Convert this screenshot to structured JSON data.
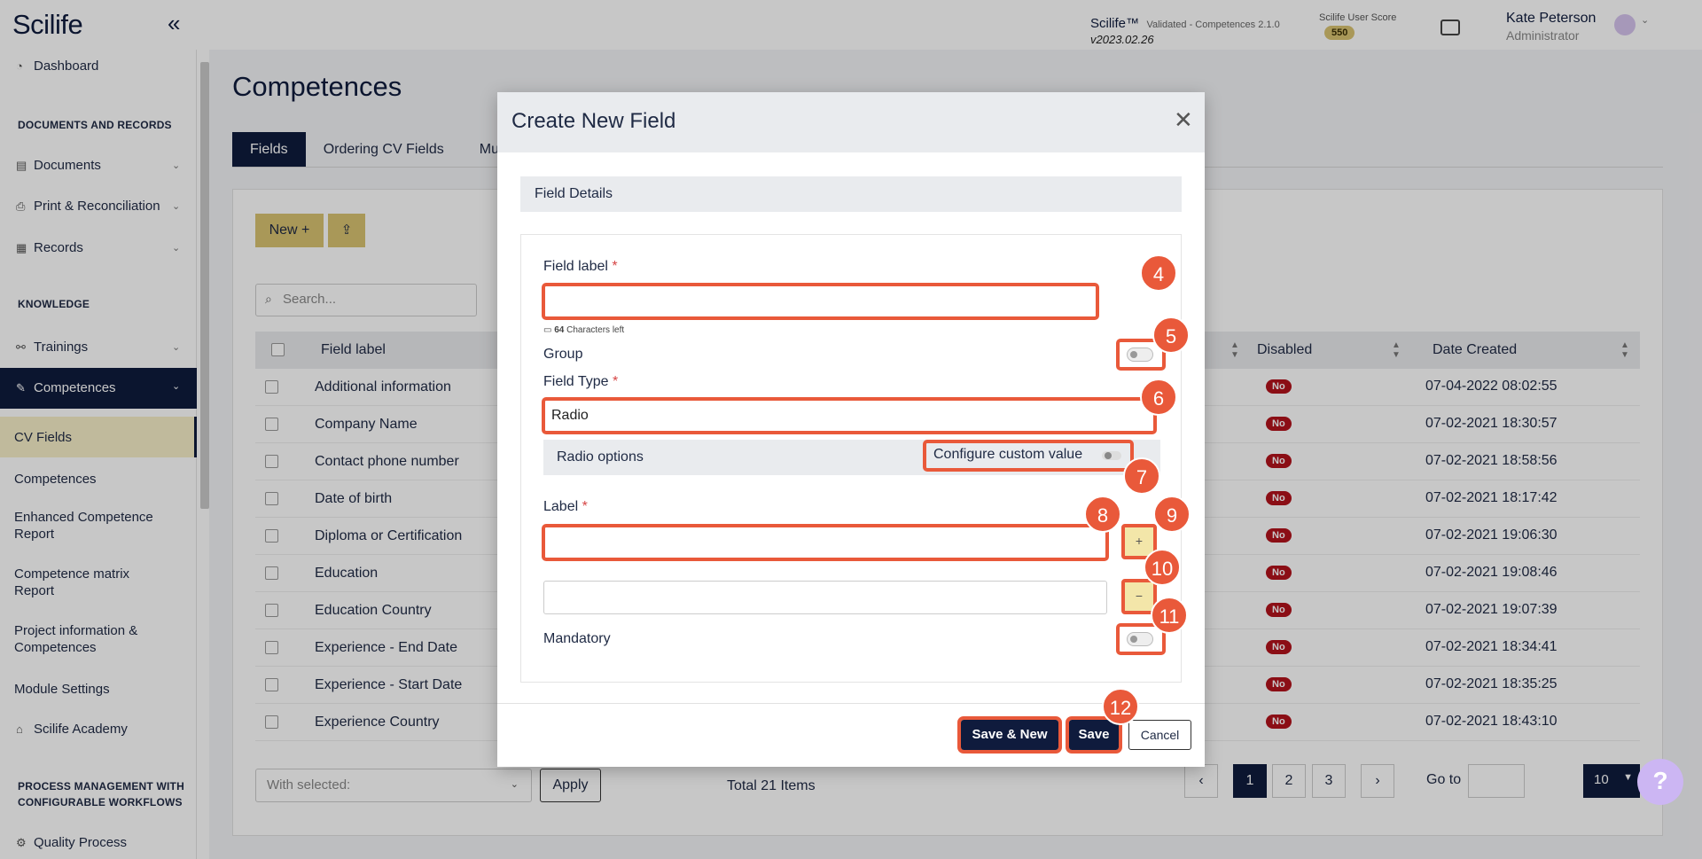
{
  "header": {
    "logo": "Scilife",
    "collapse_icon": "double-chevron-left-icon",
    "brand": "Scilife™",
    "edition": "Validated - Competences 2.1.0",
    "version": "v2023.02.26",
    "score_label": "Scilife User Score",
    "score_value": "550",
    "user_name": "Kate Peterson",
    "user_role": "Administrator"
  },
  "sidebar": {
    "dashboard": "Dashboard",
    "section_docs": "DOCUMENTS AND RECORDS",
    "documents": "Documents",
    "print": "Print & Reconciliation",
    "records": "Records",
    "section_knowledge": "KNOWLEDGE",
    "trainings": "Trainings",
    "competences": "Competences",
    "sub_items": [
      "CV Fields",
      "Competences",
      "Enhanced Competence Report",
      "Competence matrix Report",
      "Project information & Competences",
      "Module Settings"
    ],
    "academy": "Scilife Academy",
    "section_process": "PROCESS MANAGEMENT WITH CONFIGURABLE WORKFLOWS",
    "quality": "Quality Process"
  },
  "main": {
    "title": "Competences",
    "tabs": [
      "Fields",
      "Ordering CV Fields",
      "Mult"
    ],
    "new_label": "New +",
    "search_placeholder": "Search...",
    "columns": [
      "Field label",
      "Disabled",
      "Date Created"
    ],
    "rows": [
      {
        "label": "Additional information",
        "disabled": "No",
        "date": "07-04-2022 08:02:55"
      },
      {
        "label": "Company Name",
        "disabled": "No",
        "date": "07-02-2021 18:30:57"
      },
      {
        "label": "Contact phone number",
        "disabled": "No",
        "date": "07-02-2021 18:58:56"
      },
      {
        "label": "Date of birth",
        "disabled": "No",
        "date": "07-02-2021 18:17:42"
      },
      {
        "label": "Diploma or Certification",
        "disabled": "No",
        "date": "07-02-2021 19:06:30"
      },
      {
        "label": "Education",
        "disabled": "No",
        "date": "07-02-2021 19:08:46"
      },
      {
        "label": "Education Country",
        "disabled": "No",
        "date": "07-02-2021 19:07:39"
      },
      {
        "label": "Experience - End Date",
        "disabled": "No",
        "date": "07-02-2021 18:34:41"
      },
      {
        "label": "Experience - Start Date",
        "disabled": "No",
        "date": "07-02-2021 18:35:25"
      },
      {
        "label": "Experience Country",
        "disabled": "No",
        "date": "07-02-2021 18:43:10"
      }
    ],
    "with_selected": "With selected:",
    "apply": "Apply",
    "total": "Total 21 Items",
    "pages": [
      "1",
      "2",
      "3"
    ],
    "goto_label": "Go to",
    "per_page": "10",
    "help": "?"
  },
  "modal": {
    "title": "Create New Field",
    "section": "Field Details",
    "field_label": "Field label",
    "field_label_value": "",
    "chars_count": "64",
    "chars_text": "Characters left",
    "group": "Group",
    "field_type": "Field Type",
    "field_type_value": "Radio",
    "radio_options": "Radio options",
    "configure_custom": "Configure custom value",
    "label": "Label",
    "label_value": "",
    "plus": "+",
    "minus": "−",
    "mandatory": "Mandatory",
    "save_new": "Save & New",
    "save": "Save",
    "cancel": "Cancel",
    "required_mark": "*"
  },
  "markers": [
    "4",
    "5",
    "6",
    "7",
    "8",
    "9",
    "10",
    "11",
    "12"
  ],
  "colors": {
    "navy": "#0f1b3d",
    "gold": "#d9c371",
    "highlight": "#e9593a",
    "badge_red": "#b3121c"
  }
}
